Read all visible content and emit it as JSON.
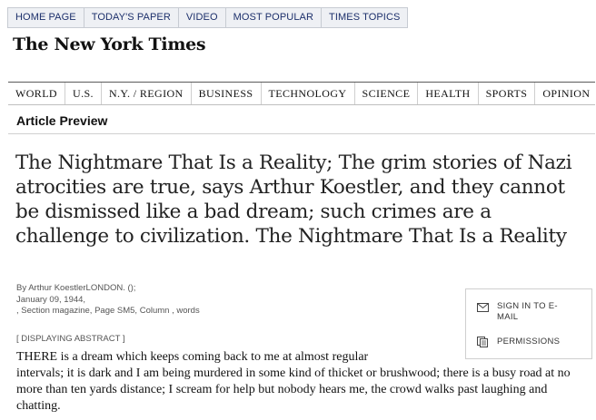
{
  "top_nav": {
    "items": [
      "HOME PAGE",
      "TODAY'S PAPER",
      "VIDEO",
      "MOST POPULAR",
      "TIMES TOPICS"
    ]
  },
  "logo": {
    "text": "The New York Times"
  },
  "section_nav": {
    "items": [
      "WORLD",
      "U.S.",
      "N.Y. / REGION",
      "BUSINESS",
      "TECHNOLOGY",
      "SCIENCE",
      "HEALTH",
      "SPORTS",
      "OPINION"
    ]
  },
  "page": {
    "label": "Article Preview"
  },
  "article": {
    "headline": "The Nightmare That Is a Reality; The grim stories of Nazi atrocities are true, says Arthur Koestler, and they cannot be dismissed like a bad dream; such crimes are a challenge to civilization. The Nightmare That Is a Reality",
    "byline": "By Arthur KoestlerLONDON. ();",
    "date": "January 09, 1944,",
    "section": ", Section magazine, Page SM5, Column , words",
    "abstract_label": "[ DISPLAYING ABSTRACT ]",
    "abstract_line1": "THERE is a dream which keeps coming back to me at almost regular",
    "abstract_rest": "intervals; it is dark and I am being murdered in some kind of thicket or brushwood; there is a busy road at no more than ten yards distance; I scream for help but nobody hears me, the crowd walks past laughing and chatting."
  },
  "tools": {
    "sign_in": "SIGN IN TO E-MAIL",
    "permissions": "PERMISSIONS",
    "icons": [
      "envelope-icon",
      "permissions-icon"
    ]
  }
}
